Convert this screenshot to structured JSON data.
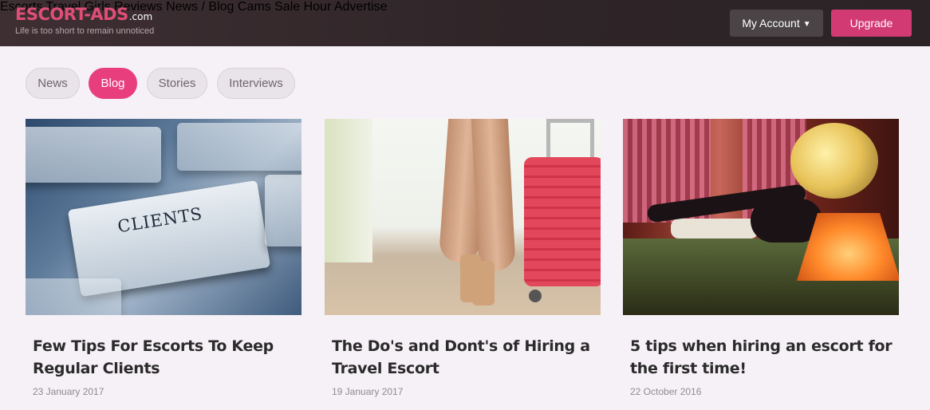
{
  "header": {
    "logo_text": "ESCORT-ADS",
    "logo_suffix": ".com",
    "tagline": "Life is too short to remain unnoticed",
    "nav": [
      {
        "label": "Escorts"
      },
      {
        "label": "Travel Girls"
      },
      {
        "label": "Reviews"
      },
      {
        "label": "News / Blog"
      },
      {
        "label": "Cams"
      },
      {
        "label": "Sale Hour"
      },
      {
        "label": "Advertise"
      }
    ],
    "account_label": "My Account",
    "upgrade_label": "Upgrade"
  },
  "filters": [
    {
      "label": "News",
      "active": false
    },
    {
      "label": "Blog",
      "active": true
    },
    {
      "label": "Stories",
      "active": false
    },
    {
      "label": "Interviews",
      "active": false
    }
  ],
  "articles": [
    {
      "image_label": "CLIENTS",
      "title": "Few Tips For Escorts To Keep Regular Clients",
      "date": "23 January 2017"
    },
    {
      "title": "The Do's and Dont's of Hiring a Travel Escort",
      "date": "19 January 2017"
    },
    {
      "title": "5 tips when hiring an escort for the first time!",
      "date": "22 October 2016"
    }
  ],
  "colors": {
    "accent": "#e83e7e",
    "header_bg": "#2f2528",
    "upgrade": "#d23a74"
  },
  "icons": {
    "account_dropdown": "chevron-down-icon"
  }
}
